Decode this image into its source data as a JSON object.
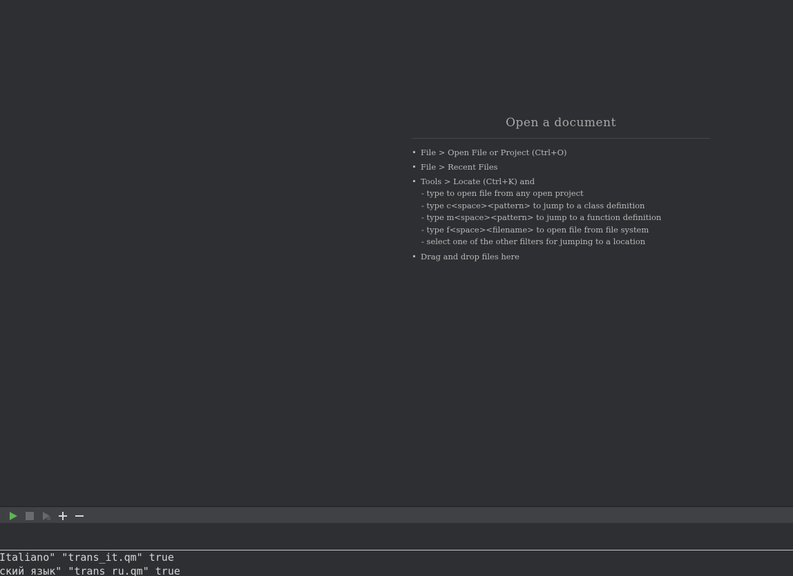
{
  "welcome": {
    "title": "Open a document",
    "items": [
      "File > Open File or Project (Ctrl+O)",
      "File > Recent Files",
      "Tools > Locate (Ctrl+K) and",
      "Drag and drop files here"
    ],
    "locate_subitems": [
      "- type to open file from any open project",
      "- type c<space><pattern> to jump to a class definition",
      "- type m<space><pattern> to jump to a function definition",
      "- type f<space><filename> to open file from file system",
      "- select one of the other filters for jumping to a location"
    ]
  },
  "toolbar": {
    "run_icon": "play-icon",
    "stop_icon": "stop-icon",
    "debug_icon": "debug-run-icon",
    "add_icon": "plus-icon",
    "remove_icon": "minus-icon",
    "run_color": "#5fb355"
  },
  "output": {
    "lines": [
      "Italiano\" \"trans_it.qm\" true",
      "ский язык\" \"trans_ru.qm\" true"
    ]
  }
}
